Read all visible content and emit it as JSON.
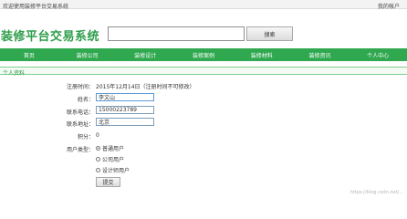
{
  "topbar": {
    "left_text": "欢迎使用装修平台交易系统",
    "right_text": "我的帐户"
  },
  "header": {
    "logo_text": "装修平台交易系统",
    "search_placeholder": "",
    "search_button_label": "搜索"
  },
  "nav": {
    "items": [
      {
        "label": "首页"
      },
      {
        "label": "装修公司"
      },
      {
        "label": "装修设计"
      },
      {
        "label": "装修案例"
      },
      {
        "label": "装修材料"
      },
      {
        "label": "装修资讯"
      },
      {
        "label": "个人中心"
      }
    ]
  },
  "section": {
    "title": "个人资料"
  },
  "form": {
    "note_label": "注册时间：",
    "note_value": "2015年12月14日（注册时间不可修改）",
    "name_label": "姓名：",
    "name_value": "李文山",
    "phone_label": "联系电话：",
    "phone_value": "15000223789",
    "address_label": "联系地址：",
    "address_value": "北京",
    "points_label": "积分：",
    "points_value": "0",
    "type_label": "用户类型：",
    "type_options": [
      {
        "label": "普通用户",
        "checked": true
      },
      {
        "label": "公司用户",
        "checked": false
      },
      {
        "label": "设计师用户",
        "checked": false
      }
    ],
    "submit_label": "提交"
  },
  "footer": {
    "watermark": "https://blog.csdn.net/..."
  }
}
